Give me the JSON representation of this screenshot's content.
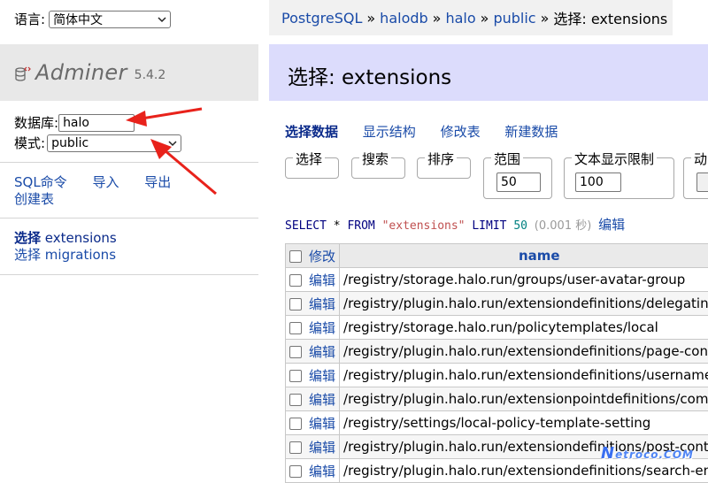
{
  "sidebar": {
    "language_label": "语言:",
    "language_value": "简体中文",
    "logo_brand": "Adminer",
    "logo_version": "5.4.2",
    "database_label": "数据库:",
    "database_value": "halo",
    "schema_label": "模式:",
    "schema_value": "public",
    "links": {
      "sql_command": "SQL命令",
      "import": "导入",
      "export": "导出",
      "create_table": "创建表"
    },
    "tables": [
      {
        "action": "选择",
        "name": "extensions"
      },
      {
        "action": "选择",
        "name": "migrations"
      }
    ]
  },
  "breadcrumb": {
    "items": [
      "PostgreSQL",
      "halodb",
      "halo",
      "public"
    ],
    "current": "选择: extensions",
    "separator": "»"
  },
  "title": "选择: extensions",
  "tabs": [
    "选择数据",
    "显示结构",
    "修改表",
    "新建数据"
  ],
  "filters": {
    "select": "选择",
    "search": "搜索",
    "sort": "排序",
    "limit_label": "范围",
    "limit_value": "50",
    "text_length_label": "文本显示限制",
    "text_length_value": "100",
    "action_label": "动"
  },
  "sql": {
    "select_kw": "SELECT",
    "star": "*",
    "from_kw": "FROM",
    "table": "\"extensions\"",
    "limit_kw": "LIMIT",
    "limit_num": "50",
    "time": "(0.001 秒)",
    "edit": "编辑"
  },
  "grid": {
    "header_modify": "修改",
    "header_name": "name",
    "edit_label": "编辑",
    "rows": [
      "/registry/storage.halo.run/groups/user-avatar-group",
      "/registry/plugin.halo.run/extensiondefinitions/delegating-lo",
      "/registry/storage.halo.run/policytemplates/local",
      "/registry/plugin.halo.run/extensiondefinitions/page-content",
      "/registry/plugin.halo.run/extensiondefinitions/username-pa",
      "/registry/plugin.halo.run/extensionpointdefinitions/commer",
      "/registry/settings/local-policy-template-setting",
      "/registry/plugin.halo.run/extensiondefinitions/post-content",
      "/registry/plugin.halo.run/extensiondefinitions/search-engin"
    ]
  },
  "watermark": {
    "main": "N",
    "sub": "etroco.COM"
  },
  "colors": {
    "link": "#1a4ba8",
    "title_bg": "#dcdcfc",
    "arrow": "#e8221b"
  }
}
